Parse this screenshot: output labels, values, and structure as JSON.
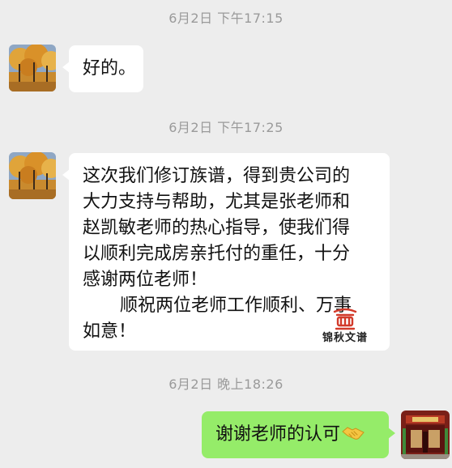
{
  "messages": {
    "ts1": "6月2日 下午17:15",
    "msg1": "好的。",
    "ts2": "6月2日 下午17:25",
    "msg2_lines": [
      "这次我们修订族谱，得到贵公司的",
      "大力支持与帮助，尤其是张老师和",
      "赵凯敏老师的热心指导，使我们得",
      "以顺利完成房亲托付的重任，十分",
      "感谢两位老师！",
      "顺祝两位老师工作顺利、万事",
      "如意！"
    ],
    "watermark_text": "锦秋文谱",
    "ts3": "6月2日 晚上18:26",
    "msg3": "谢谢老师的认可"
  },
  "icons": {
    "handshake": "handshake-emoji-icon",
    "logo": "jinqiu-logo-icon"
  },
  "colors": {
    "background": "#ededed",
    "incoming_bubble": "#ffffff",
    "outgoing_bubble": "#95ec69",
    "timestamp": "#9a9a9a",
    "logo_red": "#d23a2a"
  }
}
